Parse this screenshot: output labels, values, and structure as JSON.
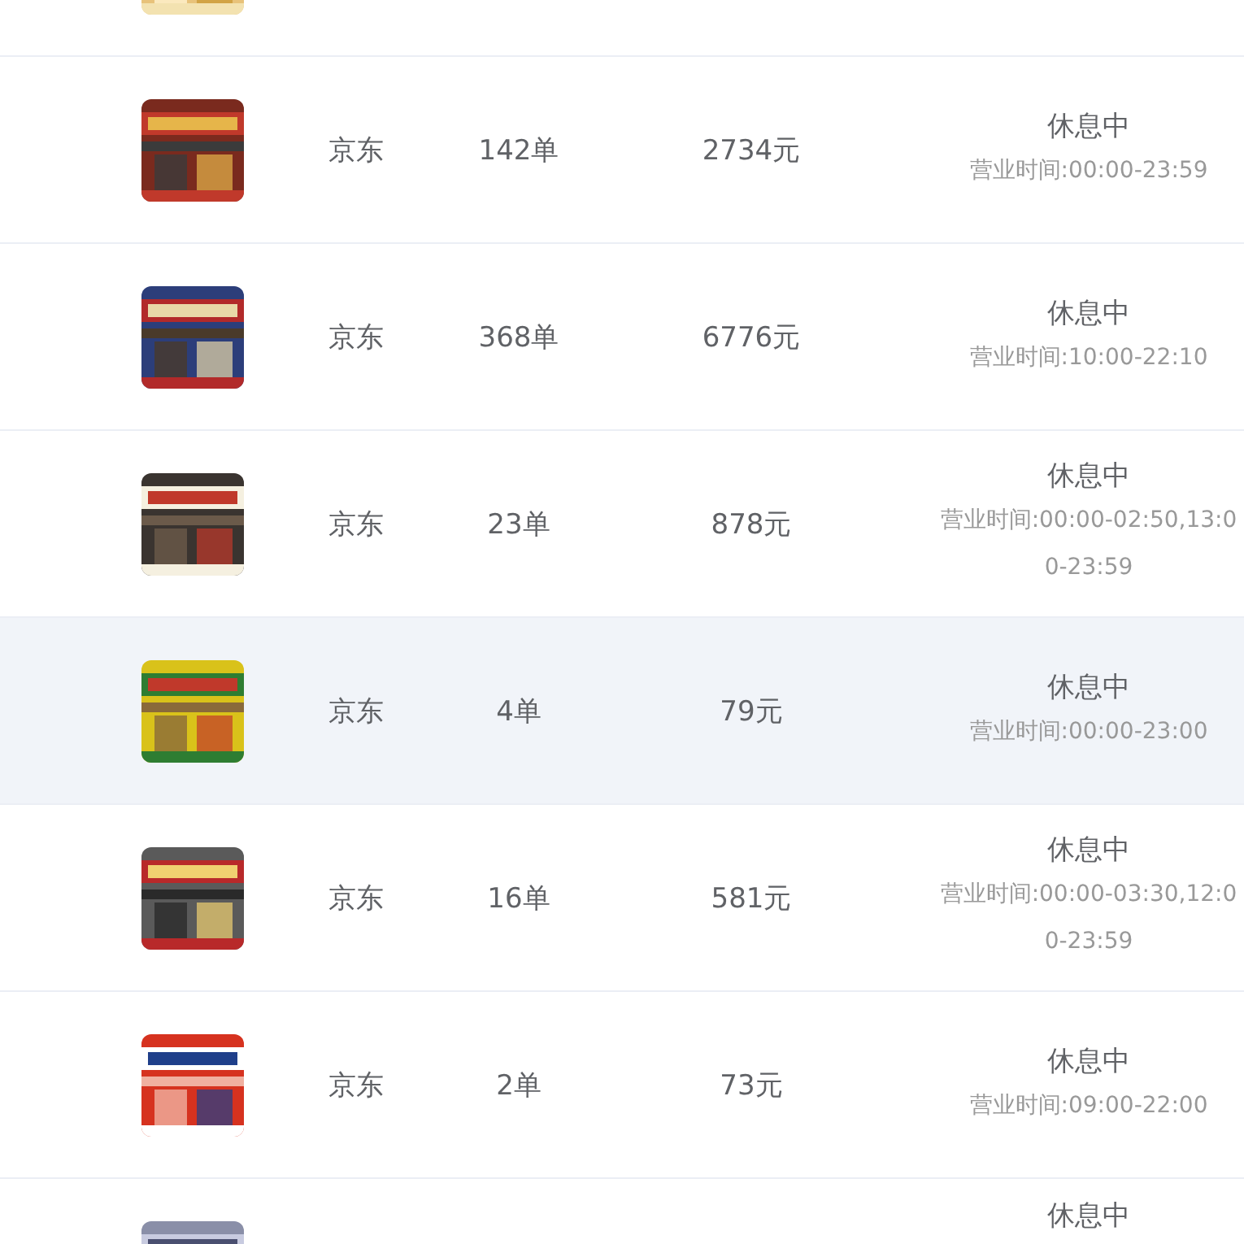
{
  "rows": [
    {
      "selected": false
    },
    {
      "platform": "京东",
      "orders": "142单",
      "amount": "2734元",
      "status": "休息中",
      "hours": "营业时间:00:00-23:59",
      "selected": false
    },
    {
      "platform": "京东",
      "orders": "368单",
      "amount": "6776元",
      "status": "休息中",
      "hours": "营业时间:10:00-22:10",
      "selected": false
    },
    {
      "platform": "京东",
      "orders": "23单",
      "amount": "878元",
      "status": "休息中",
      "hours": "营业时间:00:00-02:50,13:00-23:59",
      "selected": false
    },
    {
      "platform": "京东",
      "orders": "4单",
      "amount": "79元",
      "status": "休息中",
      "hours": "营业时间:00:00-23:00",
      "selected": true
    },
    {
      "platform": "京东",
      "orders": "16单",
      "amount": "581元",
      "status": "休息中",
      "hours": "营业时间:00:00-03:30,12:00-23:59",
      "selected": false
    },
    {
      "platform": "京东",
      "orders": "2单",
      "amount": "73元",
      "status": "休息中",
      "hours": "营业时间:09:00-22:00",
      "selected": false
    },
    {
      "status": "休息中",
      "selected": false
    }
  ]
}
